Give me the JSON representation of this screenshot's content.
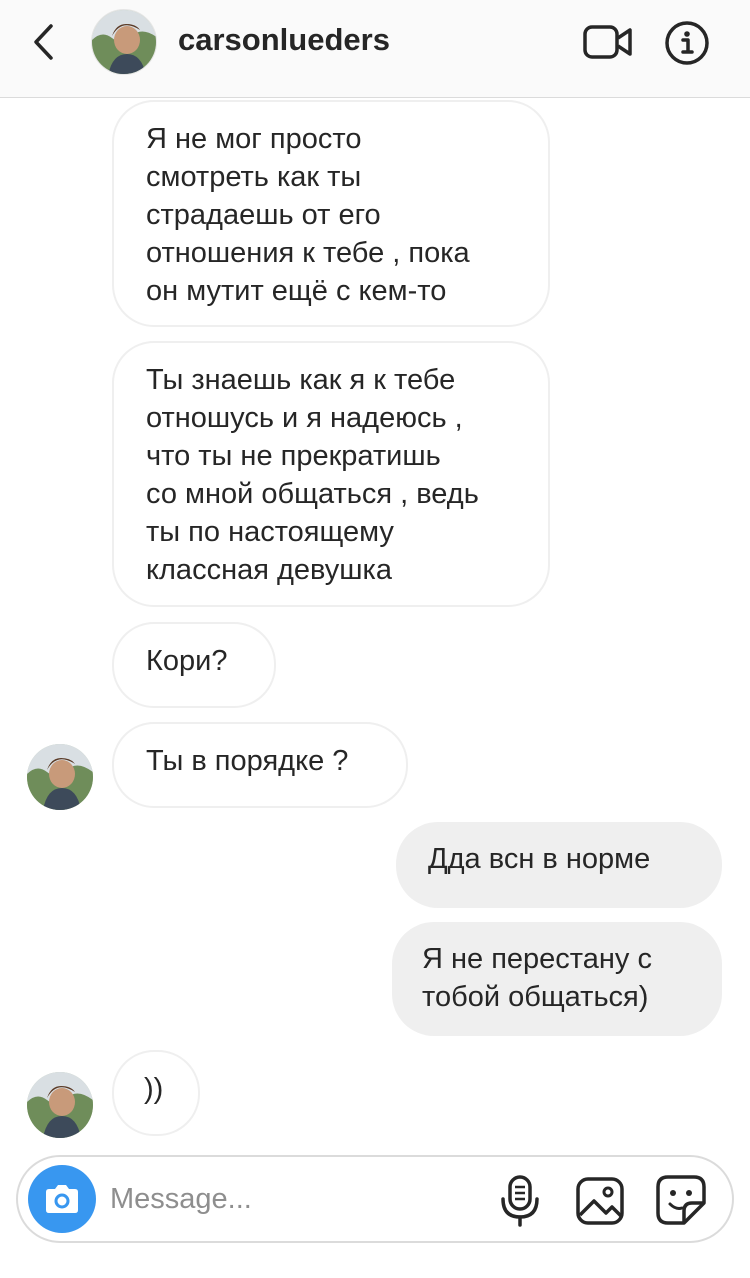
{
  "header": {
    "username": "carsonlueders",
    "back_icon": "chevron-left-icon",
    "video_icon": "video-camera-icon",
    "info_icon": "info-icon"
  },
  "messages": [
    {
      "side": "in",
      "text": "Я не мог просто\nсмотреть как ты\nстрадаешь от его\nотношения к тебе , пока\nон мутит ещё с кем-то"
    },
    {
      "side": "in",
      "text": "Ты знаешь как я к тебе\nотношусь и я надеюсь ,\nчто ты не прекратишь\nсо мной общаться , ведь\nты по настоящему\nклассная девушка"
    },
    {
      "side": "in",
      "text": "Кори?"
    },
    {
      "side": "in",
      "text": "Ты в порядке ?"
    },
    {
      "side": "out",
      "text": "Дда всн в норме"
    },
    {
      "side": "out",
      "text": "Я не перестану с\nтобой общаться)"
    },
    {
      "side": "in",
      "text": "))"
    }
  ],
  "composer": {
    "placeholder": "Message...",
    "camera_icon": "camera-icon",
    "mic_icon": "microphone-icon",
    "gallery_icon": "gallery-icon",
    "sticker_icon": "sticker-icon"
  },
  "colors": {
    "accent": "#3897f0",
    "outgoing_bubble": "#efefef",
    "incoming_border": "#efefef",
    "text": "#262626",
    "placeholder": "#8e8e8e"
  }
}
